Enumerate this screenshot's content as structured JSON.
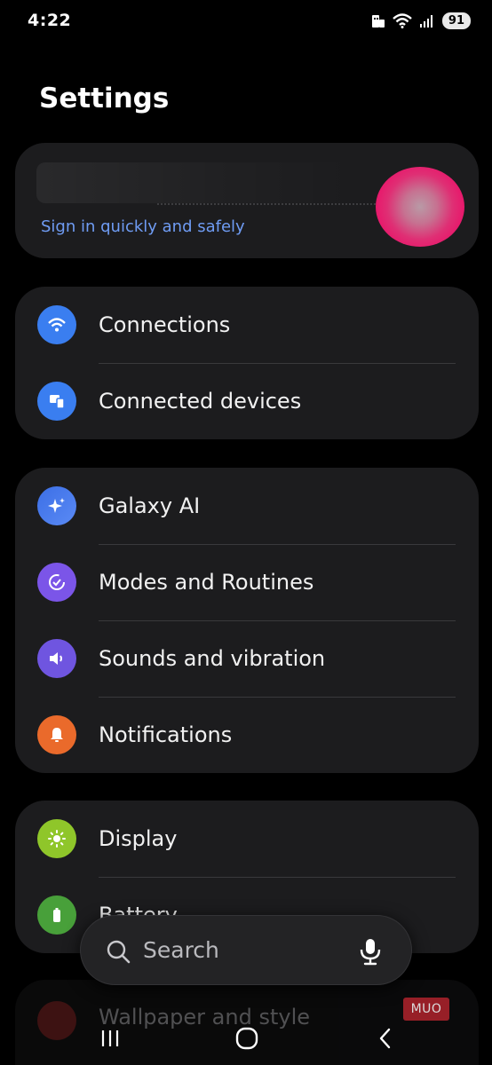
{
  "status_bar": {
    "time": "4:22",
    "battery": "91",
    "icons": [
      "notification-icon",
      "wifi-icon",
      "signal-icon",
      "battery-icon"
    ]
  },
  "page": {
    "title": "Settings"
  },
  "account": {
    "link_text": "Sign in quickly and safely",
    "link_color": "#6f9cf4"
  },
  "groups": [
    {
      "items": [
        {
          "label": "Connections",
          "icon": "wifi-icon",
          "color": "#3a7ef0"
        },
        {
          "label": "Connected devices",
          "icon": "devices-icon",
          "color": "#3a7ef0"
        }
      ]
    },
    {
      "items": [
        {
          "label": "Galaxy AI",
          "icon": "sparkle-icon",
          "color": "#3c6fe6"
        },
        {
          "label": "Modes and Routines",
          "icon": "routine-icon",
          "color": "#7b55e8"
        },
        {
          "label": "Sounds and vibration",
          "icon": "speaker-icon",
          "color": "#6f55e0"
        },
        {
          "label": "Notifications",
          "icon": "bell-icon",
          "color": "#ea6a2b"
        }
      ]
    },
    {
      "items": [
        {
          "label": "Display",
          "icon": "sun-icon",
          "color": "#8fc62a"
        },
        {
          "label": "Battery",
          "icon": "battery-icon",
          "color": "#48a03a"
        }
      ]
    }
  ],
  "search": {
    "label": "Search"
  },
  "faded_item": {
    "label": "Wallpaper and style",
    "icon": "wallpaper-icon"
  },
  "watermark": "MUO",
  "nav": {
    "recent": "recent-apps-icon",
    "home": "home-icon",
    "back": "back-icon"
  }
}
